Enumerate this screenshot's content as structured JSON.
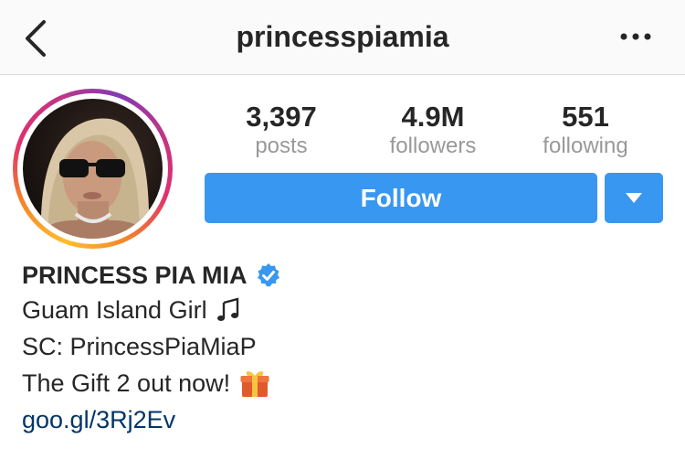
{
  "nav": {
    "username": "princesspiamia",
    "back_icon": "chevron-left-icon",
    "more_icon": "more-horizontal-icon"
  },
  "stats": [
    {
      "value": "3,397",
      "label": "posts"
    },
    {
      "value": "4.9M",
      "label": "followers"
    },
    {
      "value": "551",
      "label": "following"
    }
  ],
  "actions": {
    "follow_label": "Follow",
    "dropdown_icon": "caret-down-icon"
  },
  "profile": {
    "display_name": "PRINCESS PIA MIA",
    "verified": true,
    "bio": {
      "line1": "Guam Island Girl",
      "line1_icon": "music-note-icon",
      "line2": "SC: PrincessPiaMiaP",
      "line3": "The Gift 2 out now!",
      "line3_icon": "gift-icon",
      "link": "goo.gl/3Rj2Ev"
    }
  },
  "colors": {
    "accent": "#3897f0",
    "verified": "#3897f0",
    "link": "#003569",
    "muted": "#999999",
    "text": "#262626"
  }
}
